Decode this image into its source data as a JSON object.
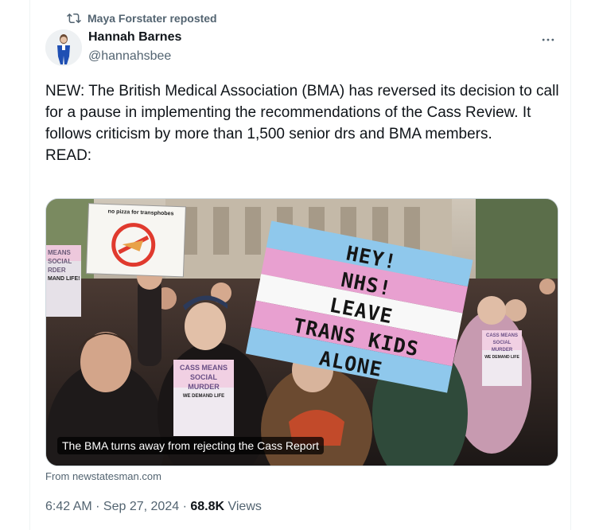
{
  "repost": {
    "label": "Maya Forstater reposted",
    "icon": "repost-icon"
  },
  "author": {
    "name": "Hannah Barnes",
    "handle": "@hannahsbee"
  },
  "tweet": {
    "text": "NEW: The British Medical Association (BMA) has reversed its decision to call for a pause in implementing the recommendations of the Cass Review. It follows criticism by more than 1,500 senior drs and BMA members.\nREAD:"
  },
  "card": {
    "caption": "The BMA turns away from rejecting the Cass Report",
    "source": "From newstatesman.com",
    "sign_main": [
      "HEY!",
      "NHS!",
      "LEAVE",
      "TRANS KIDS",
      "ALONE"
    ],
    "sign_pizza": "no pizza for transphobes",
    "sign_left": [
      "MEANS",
      "SOCIAL",
      "RDER",
      "MAND LIFE!"
    ],
    "sign_center": [
      "CASS MEANS",
      "SOCIAL",
      "MURDER",
      "WE DEMAND LIFE"
    ],
    "sign_right": [
      "CASS MEANS",
      "SOCIAL",
      "MURDER",
      "WE DEMAND LIFE"
    ]
  },
  "meta": {
    "time": "6:42 AM",
    "separator": " · ",
    "date": "Sep 27, 2024",
    "views_count": "68.8K",
    "views_label": " Views"
  },
  "colors": {
    "text_primary": "#0f1419",
    "text_secondary": "#536471",
    "trans_blue": "#8fc8ec",
    "trans_pink": "#e8a0d0"
  }
}
